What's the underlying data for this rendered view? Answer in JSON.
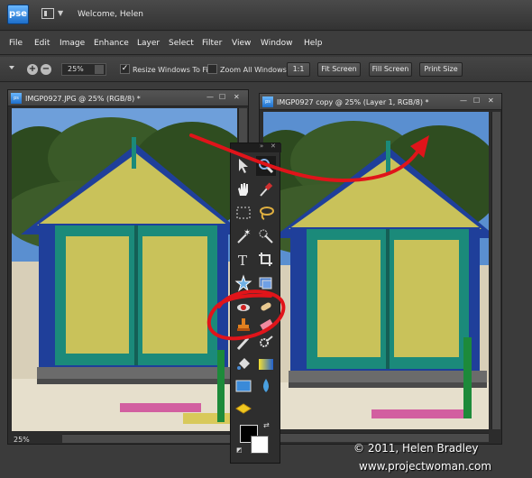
{
  "app": {
    "logo": "pse",
    "title": "Welcome, Helen"
  },
  "menu": [
    "File",
    "Edit",
    "Image",
    "Enhance",
    "Layer",
    "Select",
    "Filter",
    "View",
    "Window",
    "Help"
  ],
  "options": {
    "zoom_value": "25%",
    "resize_windows": {
      "label": "Resize Windows To Fit",
      "checked": true
    },
    "zoom_all": {
      "label": "Zoom All Windows",
      "checked": false
    },
    "buttons": [
      "1:1",
      "Fit Screen",
      "Fill Screen",
      "Print Size"
    ]
  },
  "documents": [
    {
      "name": "IMGP0927.JPG @ 25% (RGB/8) *",
      "zoom_status": "25%"
    },
    {
      "name": "IMGP0927 copy @ 25% (Layer 1, RGB/8) *"
    }
  ],
  "tools": [
    "move-tool",
    "zoom-tool",
    "hand-tool",
    "eyedropper-tool",
    "marquee-tool",
    "lasso-tool",
    "magic-wand-tool",
    "quick-selection-tool",
    "type-tool",
    "crop-tool",
    "cookie-cutter-tool",
    "straighten-tool",
    "red-eye-tool",
    "spot-healing-tool",
    "clone-stamp-tool",
    "eraser-tool",
    "brush-tool",
    "smart-brush-tool",
    "paint-bucket-tool",
    "gradient-tool",
    "shape-tool",
    "blur-tool",
    "sponge-tool"
  ],
  "watermark": {
    "line1": "© 2011, Helen Bradley",
    "line2": "www.projectwoman.com"
  },
  "colors": {
    "annotation": "#e0141a",
    "hut_yellow": "#c9c25a",
    "hut_blue": "#1f3f9a",
    "hut_teal": "#1b8a7a",
    "foreground": "#000000",
    "background": "#ffffff"
  }
}
